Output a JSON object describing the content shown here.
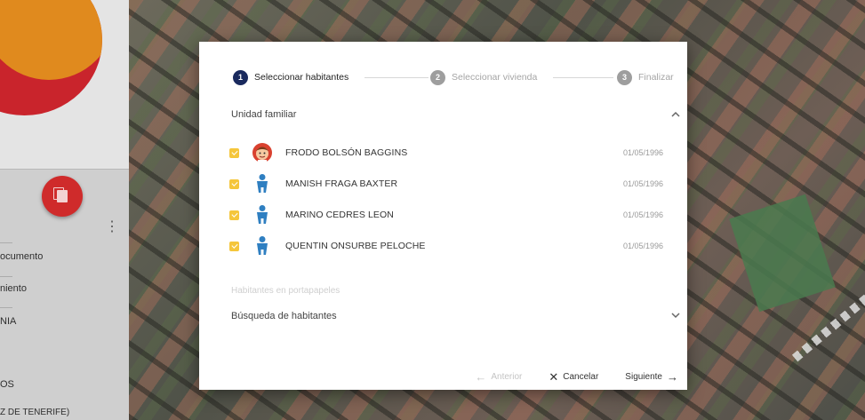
{
  "stepper": {
    "steps": [
      {
        "num": "1",
        "label": "Seleccionar habitantes"
      },
      {
        "num": "2",
        "label": "Seleccionar vivienda"
      },
      {
        "num": "3",
        "label": "Finalizar"
      }
    ]
  },
  "family_unit": {
    "title": "Unidad familiar",
    "members": [
      {
        "name": "FRODO BOLSÓN BAGGINS",
        "date": "01/05/1996",
        "avatar": "cartoon-face-icon"
      },
      {
        "name": "MANISH FRAGA BAXTER",
        "date": "01/05/1996",
        "avatar": "person-silhouette-icon"
      },
      {
        "name": "MARINO CEDRES LEON",
        "date": "01/05/1996",
        "avatar": "person-silhouette-icon"
      },
      {
        "name": "QUENTIN ONSURBE PELOCHE",
        "date": "01/05/1996",
        "avatar": "person-silhouette-icon"
      }
    ]
  },
  "clipboard_label": "Habitantes en portapapeles",
  "search_section": {
    "title": "Búsqueda de habitantes"
  },
  "actions": {
    "back": "Anterior",
    "cancel": "Cancelar",
    "next": "Siguiente"
  },
  "side_panel": {
    "field_1_value": "ocumento",
    "field_2_value": "niento",
    "field_3_value": "NIA",
    "field_4_value": "OS",
    "field_5_value": "Z DE TENERIFE)"
  },
  "colors": {
    "accent": "#f5c63b",
    "step_active": "#1a2a5e",
    "step_inactive": "#9e9e9e",
    "avatar_blue": "#2f7fc1",
    "brand_red": "#c9242c",
    "brand_orange": "#e08a1e"
  }
}
